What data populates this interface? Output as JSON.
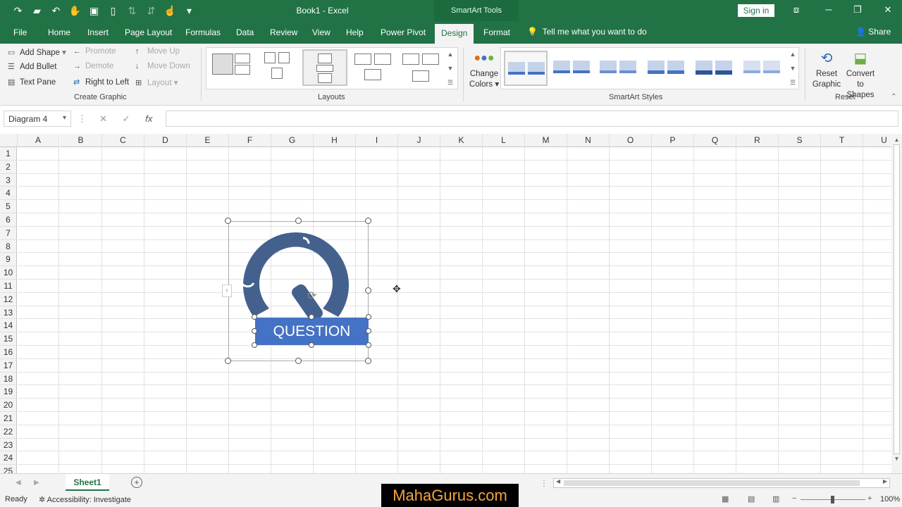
{
  "title": {
    "doc": "Book1  -  Excel",
    "context": "SmartArt Tools",
    "signin": "Sign in"
  },
  "tabs": {
    "file": "File",
    "home": "Home",
    "insert": "Insert",
    "page_layout": "Page Layout",
    "formulas": "Formulas",
    "data": "Data",
    "review": "Review",
    "view": "View",
    "help": "Help",
    "power_pivot": "Power Pivot",
    "design": "Design",
    "format": "Format",
    "tell": "Tell me what you want to do",
    "share": "Share"
  },
  "ribbon": {
    "create_graphic": {
      "add_shape": "Add Shape",
      "add_bullet": "Add Bullet",
      "text_pane": "Text Pane",
      "promote": "Promote",
      "demote": "Demote",
      "right_to_left": "Right to Left",
      "move_up": "Move Up",
      "move_down": "Move Down",
      "layout": "Layout",
      "label": "Create Graphic"
    },
    "layouts_label": "Layouts",
    "change_colors": {
      "line1": "Change",
      "line2": "Colors"
    },
    "styles_label": "SmartArt Styles",
    "reset": {
      "reset_graphic_1": "Reset",
      "reset_graphic_2": "Graphic",
      "convert_1": "Convert",
      "convert_2": "to Shapes",
      "label": "Reset"
    }
  },
  "formula_bar": {
    "name_box": "Diagram 4",
    "fx": "fx",
    "value": ""
  },
  "columns": [
    "A",
    "B",
    "C",
    "D",
    "E",
    "F",
    "G",
    "H",
    "I",
    "J",
    "K",
    "L",
    "M",
    "N",
    "O",
    "P",
    "Q",
    "R",
    "S",
    "T",
    "U"
  ],
  "rows": [
    "1",
    "2",
    "3",
    "4",
    "5",
    "6",
    "7",
    "8",
    "9",
    "10",
    "11",
    "12",
    "13",
    "14",
    "15",
    "16",
    "17",
    "18",
    "19",
    "20",
    "21",
    "22",
    "23",
    "24",
    "25"
  ],
  "smartart": {
    "text": "QUESTION"
  },
  "sheet": {
    "name": "Sheet1"
  },
  "status": {
    "ready": "Ready",
    "accessibility": "Accessibility: Investigate",
    "zoom": "100%"
  },
  "watermark": "MahaGurus.com",
  "colors": {
    "excel_green": "#217346",
    "ring": "#44618e",
    "label": "#4472c4"
  }
}
